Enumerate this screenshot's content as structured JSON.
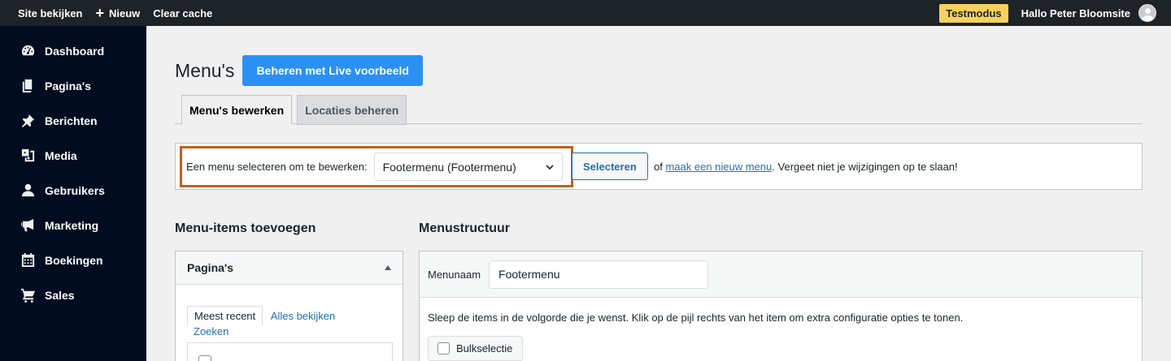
{
  "adminbar": {
    "view_site": "Site bekijken",
    "new": "Nieuw",
    "clear_cache": "Clear cache",
    "test_mode": "Testmodus",
    "greeting": "Hallo Peter Bloomsite"
  },
  "sidebar": {
    "items": [
      {
        "label": "Dashboard",
        "icon": "dashboard-icon"
      },
      {
        "label": "Pagina's",
        "icon": "pages-icon"
      },
      {
        "label": "Berichten",
        "icon": "pin-icon"
      },
      {
        "label": "Media",
        "icon": "media-icon"
      },
      {
        "label": "Gebruikers",
        "icon": "users-icon"
      },
      {
        "label": "Marketing",
        "icon": "megaphone-icon"
      },
      {
        "label": "Boekingen",
        "icon": "calendar-icon"
      },
      {
        "label": "Sales",
        "icon": "cart-icon"
      }
    ]
  },
  "header": {
    "title": "Menu's",
    "live_button": "Beheren met Live voorbeeld"
  },
  "tabs": [
    "Menu's bewerken",
    "Locaties beheren"
  ],
  "select": {
    "label": "Een menu selecteren om te bewerken:",
    "selected": "Footermenu (Footermenu)",
    "button": "Selecteren",
    "after_prefix": "of",
    "new_menu_link": "maak een nieuw menu",
    "after_suffix": ". Vergeet niet je wijzigingen op te slaan!"
  },
  "left_column": {
    "title": "Menu-items toevoegen",
    "panel_title": "Pagina's",
    "subtab_recent": "Meest recent",
    "subtab_all": "Alles bekijken",
    "subtab_search": "Zoeken"
  },
  "right_column": {
    "title": "Menustructuur",
    "menu_name_label": "Menunaam",
    "menu_name_value": "Footermenu",
    "instructions": "Sleep de items in de volgorde die je wenst. Klik op de pijl rechts van het item om extra configuratie opties te tonen.",
    "bulk_select": "Bulkselectie"
  },
  "colors": {
    "adminbar_bg": "#1d2327",
    "sidebar_bg": "#000c1f",
    "primary_button": "#2b90f5",
    "highlight_border": "#c0601c",
    "test_badge": "#f8d15c",
    "link": "#2271b1"
  }
}
